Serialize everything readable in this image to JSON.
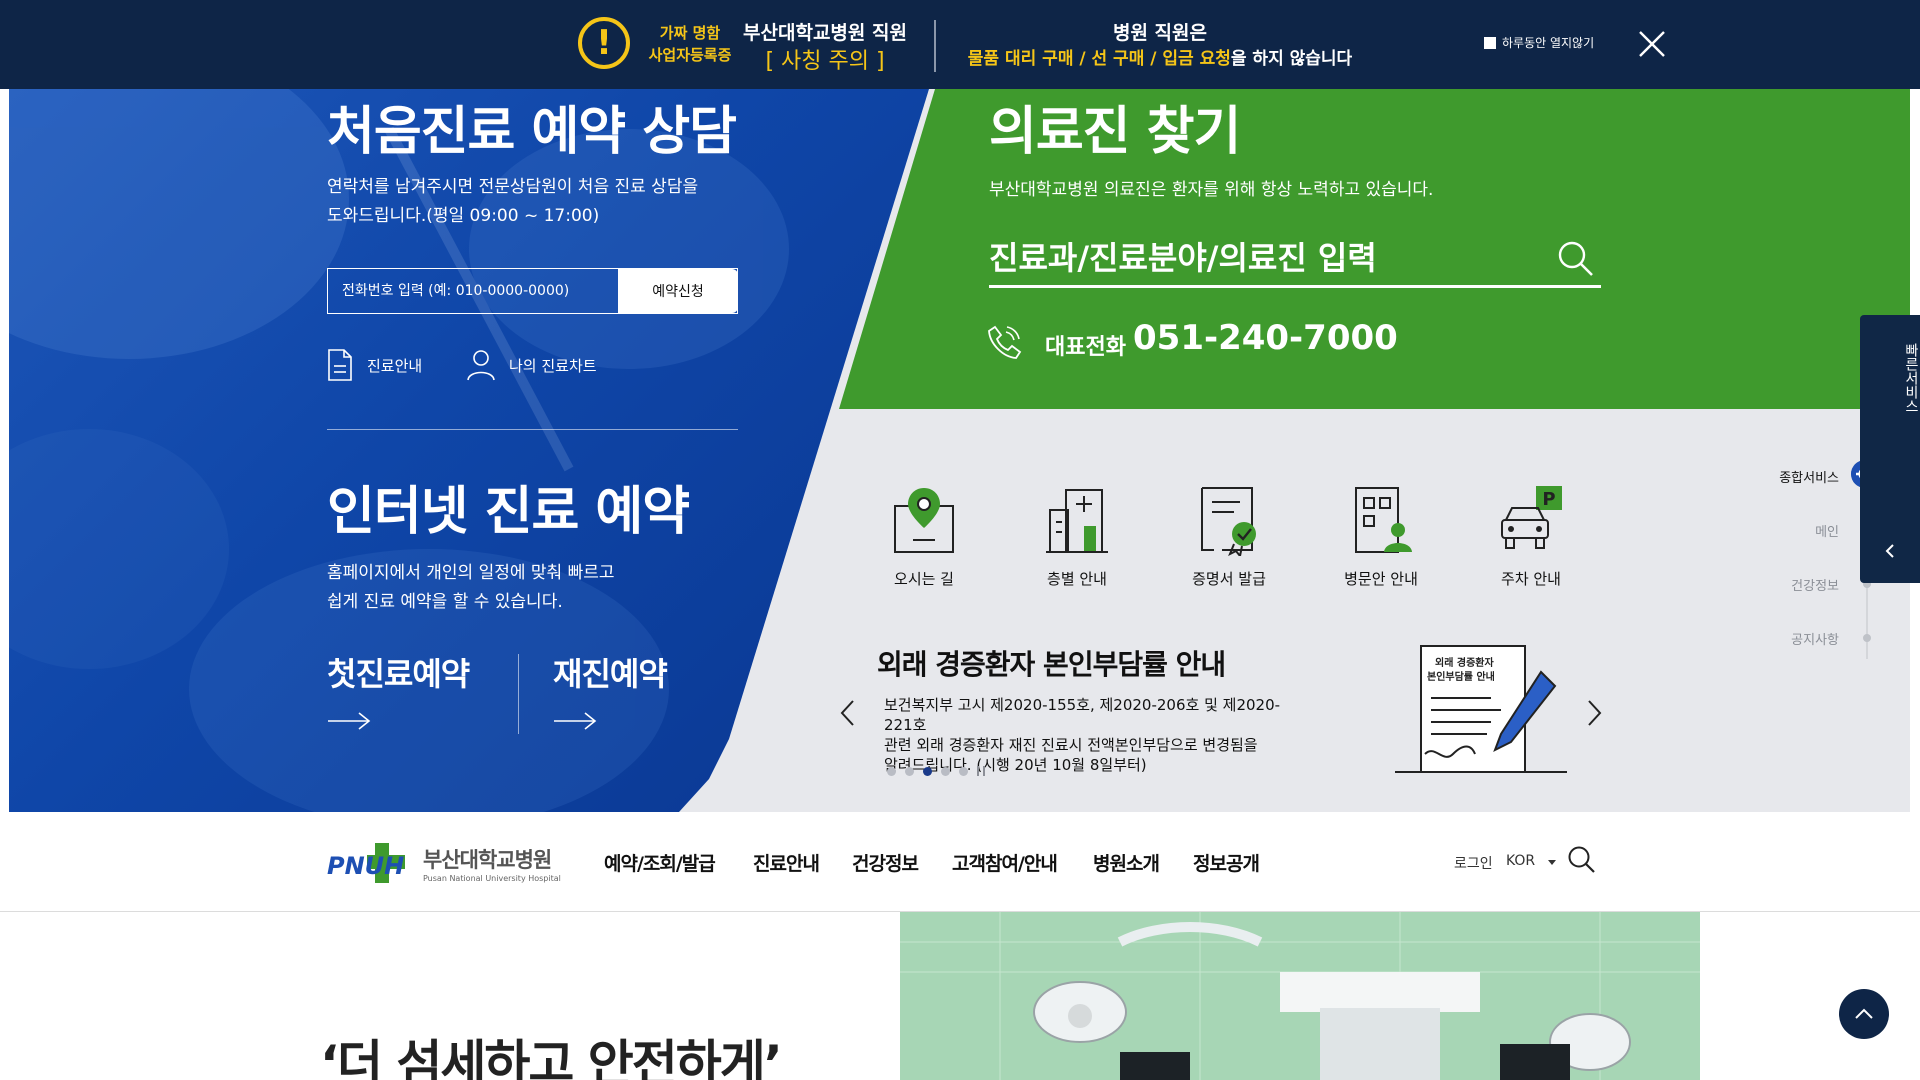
{
  "banner": {
    "tag_line1": "가짜 명함",
    "tag_line2": "사업자등록증",
    "staff": "부산대학교병원 직원",
    "caution": "[ 사칭 주의 ]",
    "title": "병원 직원은",
    "body_highlight": "물품 대리 구매 / 선 구매 / 입금 요청",
    "body_rest": "을 하지 않습니다",
    "dismiss_label": "하루동안 열지않기",
    "colors": {
      "background": "#0e2547",
      "highlight": "#f5c518"
    }
  },
  "first_visit": {
    "title": "처음진료 예약 상담",
    "desc_line1": "연락처를 남겨주시면 전문상담원이 처음 진료 상담을",
    "desc_line2": "도와드립니다.(평일 09:00 ~ 17:00)",
    "phone_placeholder": "전화번호 입력 (예: 010-0000-0000)",
    "reserve_button": "예약신청",
    "links": [
      "진료안내",
      "나의 진료차트"
    ]
  },
  "internet": {
    "title": "인터넷 진료 예약",
    "desc_line1": "홈페이지에서 개인의 일정에 맞춰 빠르고",
    "desc_line2": "쉽게 진료 예약을 할 수 있습니다.",
    "buttons": [
      "첫진료예약",
      "재진예약"
    ]
  },
  "doctor": {
    "title": "의료진 찾기",
    "desc": "부산대학교병원 의료진은 환자를 위해 항상 노력하고 있습니다.",
    "search_placeholder": "진료과/진료분야/의료진 입력",
    "call_label": "대표전화",
    "call_number": "051-240-7000",
    "color": "#3f9a2d"
  },
  "services": [
    "오시는 길",
    "층별 안내",
    "증명서 발급",
    "병문안 안내",
    "주차 안내"
  ],
  "notice": {
    "title": "외래 경증환자 본인부담률 안내",
    "desc_line1": "보건복지부 고시 제2020-155호, 제2020-206호 및 제2020-221호",
    "desc_line2": "관련 외래 경증환자 재진 진료시 전액본인부담으로 변경됨을",
    "desc_line3": "알려드립니다. (시행 20년 10월 8일부터)",
    "illustration_line1": "외래 경증환자",
    "illustration_line2": "본인부담률 안내",
    "dots_total": 5,
    "dots_active": 3
  },
  "side_nav": {
    "items": [
      "종합서비스",
      "메인",
      "건강정보",
      "공지사항"
    ]
  },
  "quick_service": {
    "label": "빠른서비스"
  },
  "nav": {
    "logo_mark": "PNUH",
    "logo_kor": "부산대학교병원",
    "logo_eng": "Pusan National University Hospital",
    "items": [
      "예약/조회/발급",
      "진료안내",
      "건강정보",
      "고객참여/안내",
      "병원소개",
      "정보공개"
    ],
    "login": "로그인",
    "lang": "KOR"
  },
  "lower": {
    "title": "‘더 섬세하고 안전하게’"
  }
}
